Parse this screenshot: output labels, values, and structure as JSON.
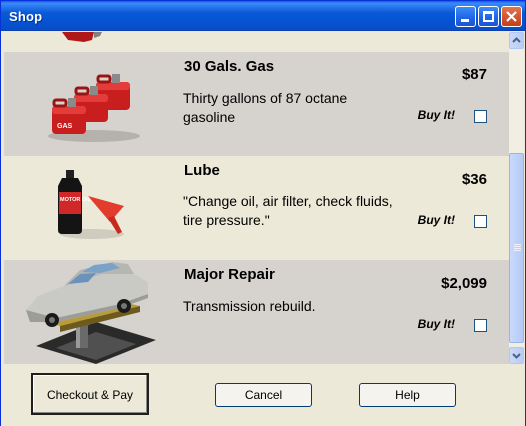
{
  "window": {
    "title": "Shop"
  },
  "items": [
    {
      "title": "30 Gals. Gas",
      "price": "$87",
      "description": "Thirty gallons of 87 octane gasoline",
      "buy_label": "Buy It!",
      "image": "gas-cans-icon",
      "gas_label": "GAS"
    },
    {
      "title": "Lube",
      "price": "$36",
      "description": "\"Change oil, air filter, check fluids, tire pressure.\"",
      "buy_label": "Buy It!",
      "image": "motor-oil-icon",
      "oil_label": "MOTOR OIL"
    },
    {
      "title": "Major Repair",
      "price": "$2,099",
      "description": "Transmission rebuild.",
      "buy_label": "Buy It!",
      "image": "car-lift-icon"
    }
  ],
  "buttons": {
    "checkout": "Checkout & Pay",
    "cancel": "Cancel",
    "help": "Help"
  }
}
